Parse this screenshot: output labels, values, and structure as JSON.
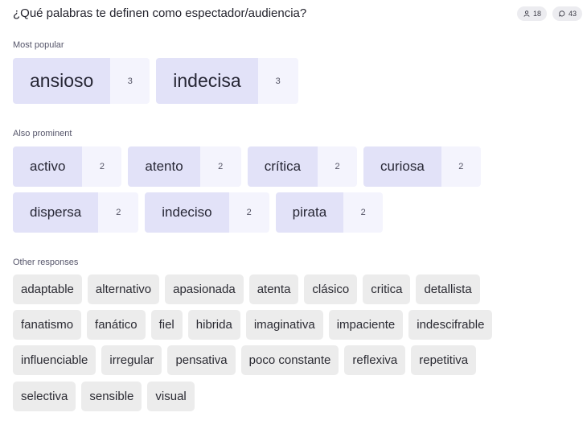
{
  "question": "¿Qué palabras te definen como espectador/audiencia?",
  "badges": {
    "participants": {
      "icon": "person-icon",
      "value": "18"
    },
    "responses": {
      "icon": "chat-icon",
      "value": "43"
    }
  },
  "sections": {
    "most_popular": {
      "label": "Most popular"
    },
    "also_prominent": {
      "label": "Also prominent"
    },
    "other": {
      "label": "Other responses"
    }
  },
  "most_popular": [
    {
      "word": "ansioso",
      "count": "3"
    },
    {
      "word": "indecisa",
      "count": "3"
    }
  ],
  "also_prominent": [
    {
      "word": "activo",
      "count": "2"
    },
    {
      "word": "atento",
      "count": "2"
    },
    {
      "word": "crítica",
      "count": "2"
    },
    {
      "word": "curiosa",
      "count": "2"
    },
    {
      "word": "dispersa",
      "count": "2"
    },
    {
      "word": "indeciso",
      "count": "2"
    },
    {
      "word": "pirata",
      "count": "2"
    }
  ],
  "other_responses": [
    "adaptable",
    "alternativo",
    "apasionada",
    "atenta",
    "clásico",
    "critica",
    "detallista",
    "fanatismo",
    "fanático",
    "fiel",
    "hibrida",
    "imaginativa",
    "impaciente",
    "indescifrable",
    "influenciable",
    "irregular",
    "pensativa",
    "poco constante",
    "reflexiva",
    "repetitiva",
    "selectiva",
    "sensible",
    "visual"
  ],
  "colors": {
    "pill_word_bg": "#e2e2f8",
    "pill_count_bg": "#f4f4fd",
    "tag_bg": "#ececec"
  }
}
